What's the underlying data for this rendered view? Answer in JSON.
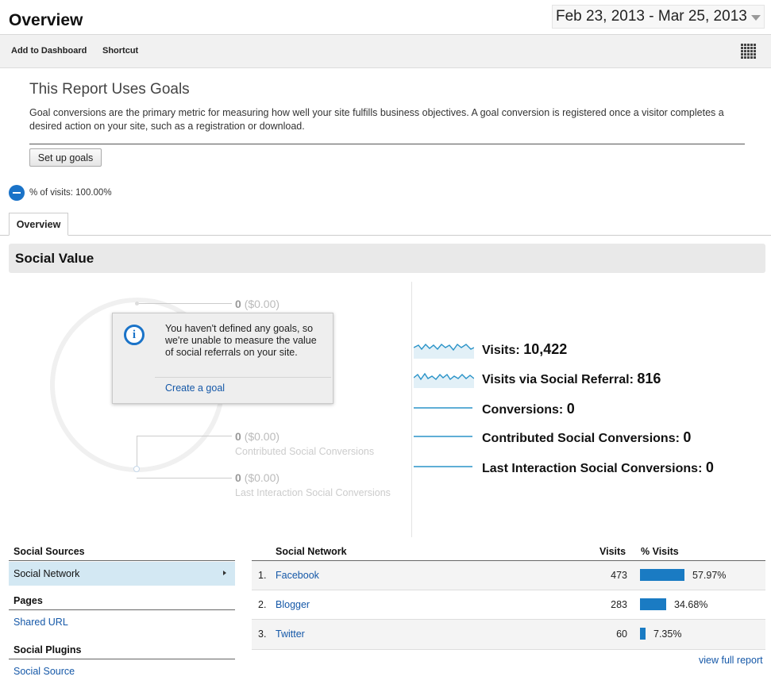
{
  "header": {
    "title": "Overview",
    "date_range": "Feb 23, 2013 - Mar 25, 2013"
  },
  "toolbar": {
    "add_to_dashboard": "Add to Dashboard",
    "shortcut": "Shortcut"
  },
  "goals_notice": {
    "title": "This Report Uses Goals",
    "description": "Goal conversions are the primary metric for measuring how well your site fulfills business objectives. A goal conversion is registered once a visitor completes a desired action on your site, such as a registration or download.",
    "button": "Set up goals"
  },
  "segment": {
    "label": "% of visits: 100.00%"
  },
  "tabs": [
    {
      "label": "Overview"
    }
  ],
  "section": {
    "title": "Social Value"
  },
  "donut": {
    "top_value": "0",
    "top_money": "($0.00)",
    "contributed_value": "0",
    "contributed_money": "($0.00)",
    "contributed_label": "Contributed Social Conversions",
    "last_value": "0",
    "last_money": "($0.00)",
    "last_label": "Last Interaction Social Conversions"
  },
  "tooltip": {
    "message": "You haven't defined any goals, so we're unable to measure the value of social referrals on your site.",
    "link": "Create a goal"
  },
  "metrics": [
    {
      "label": "Visits:",
      "value": "10,422",
      "sparkline": "wavy"
    },
    {
      "label": "Visits via Social Referral:",
      "value": "816",
      "sparkline": "wavy"
    },
    {
      "label": "Conversions:",
      "value": "0",
      "sparkline": "flat"
    },
    {
      "label": "Contributed Social Conversions:",
      "value": "0",
      "sparkline": "flat"
    },
    {
      "label": "Last Interaction Social Conversions:",
      "value": "0",
      "sparkline": "flat"
    }
  ],
  "sidebar": {
    "social_sources_heading": "Social Sources",
    "social_network": "Social Network",
    "pages_heading": "Pages",
    "shared_url": "Shared URL",
    "social_plugins_heading": "Social Plugins",
    "social_source": "Social Source"
  },
  "table": {
    "col_network": "Social Network",
    "col_visits": "Visits",
    "col_pct": "% Visits",
    "rows": [
      {
        "index": "1.",
        "name": "Facebook",
        "visits": "473",
        "pct": "57.97%",
        "share": 0.5797
      },
      {
        "index": "2.",
        "name": "Blogger",
        "visits": "283",
        "pct": "34.68%",
        "share": 0.3468
      },
      {
        "index": "3.",
        "name": "Twitter",
        "visits": "60",
        "pct": "7.35%",
        "share": 0.0735
      }
    ],
    "view_full_report": "view full report"
  },
  "colors": {
    "accent": "#1a73c8",
    "bar": "#1a7bc3",
    "link": "#1558a8",
    "selected_row": "#d3e8f3"
  }
}
